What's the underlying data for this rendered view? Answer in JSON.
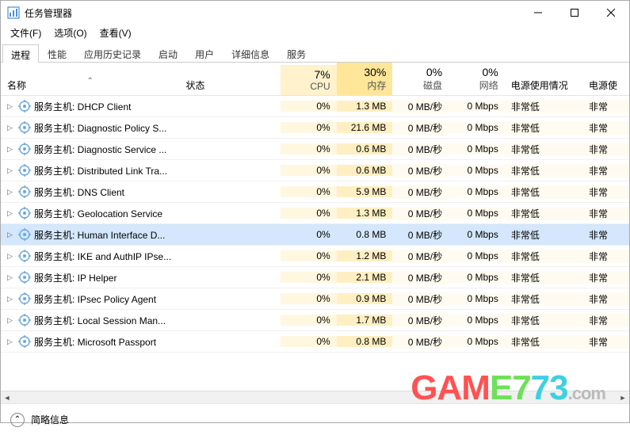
{
  "window": {
    "title": "任务管理器"
  },
  "menu": {
    "file": "文件(F)",
    "options": "选项(O)",
    "view": "查看(V)"
  },
  "tabs": [
    "进程",
    "性能",
    "应用历史记录",
    "启动",
    "用户",
    "详细信息",
    "服务"
  ],
  "active_tab": 0,
  "columns": {
    "name": "名称",
    "status": "状态",
    "cpu": {
      "pct": "7%",
      "lbl": "CPU"
    },
    "mem": {
      "pct": "30%",
      "lbl": "内存"
    },
    "disk": {
      "pct": "0%",
      "lbl": "磁盘"
    },
    "net": {
      "pct": "0%",
      "lbl": "网络"
    },
    "power": "电源使用情况",
    "power2": "电源使"
  },
  "rows": [
    {
      "name": "服务主机: DHCP Client",
      "cpu": "0%",
      "mem": "1.3 MB",
      "disk": "0 MB/秒",
      "net": "0 Mbps",
      "power": "非常低",
      "power2": "非常"
    },
    {
      "name": "服务主机: Diagnostic Policy S...",
      "cpu": "0%",
      "mem": "21.6 MB",
      "disk": "0 MB/秒",
      "net": "0 Mbps",
      "power": "非常低",
      "power2": "非常"
    },
    {
      "name": "服务主机: Diagnostic Service ...",
      "cpu": "0%",
      "mem": "0.6 MB",
      "disk": "0 MB/秒",
      "net": "0 Mbps",
      "power": "非常低",
      "power2": "非常"
    },
    {
      "name": "服务主机: Distributed Link Tra...",
      "cpu": "0%",
      "mem": "0.6 MB",
      "disk": "0 MB/秒",
      "net": "0 Mbps",
      "power": "非常低",
      "power2": "非常"
    },
    {
      "name": "服务主机: DNS Client",
      "cpu": "0%",
      "mem": "5.9 MB",
      "disk": "0 MB/秒",
      "net": "0 Mbps",
      "power": "非常低",
      "power2": "非常"
    },
    {
      "name": "服务主机: Geolocation Service",
      "cpu": "0%",
      "mem": "1.3 MB",
      "disk": "0 MB/秒",
      "net": "0 Mbps",
      "power": "非常低",
      "power2": "非常"
    },
    {
      "name": "服务主机: Human Interface D...",
      "cpu": "0%",
      "mem": "0.8 MB",
      "disk": "0 MB/秒",
      "net": "0 Mbps",
      "power": "非常低",
      "power2": "非常",
      "selected": true
    },
    {
      "name": "服务主机: IKE and AuthIP IPse...",
      "cpu": "0%",
      "mem": "1.2 MB",
      "disk": "0 MB/秒",
      "net": "0 Mbps",
      "power": "非常低",
      "power2": "非常"
    },
    {
      "name": "服务主机: IP Helper",
      "cpu": "0%",
      "mem": "2.1 MB",
      "disk": "0 MB/秒",
      "net": "0 Mbps",
      "power": "非常低",
      "power2": "非常"
    },
    {
      "name": "服务主机: IPsec Policy Agent",
      "cpu": "0%",
      "mem": "0.9 MB",
      "disk": "0 MB/秒",
      "net": "0 Mbps",
      "power": "非常低",
      "power2": "非常"
    },
    {
      "name": "服务主机: Local Session Man...",
      "cpu": "0%",
      "mem": "1.7 MB",
      "disk": "0 MB/秒",
      "net": "0 Mbps",
      "power": "非常低",
      "power2": "非常"
    },
    {
      "name": "服务主机: Microsoft Passport",
      "cpu": "0%",
      "mem": "0.8 MB",
      "disk": "0 MB/秒",
      "net": "0 Mbps",
      "power": "非常低",
      "power2": "非常"
    }
  ],
  "footer": {
    "label": "简略信息"
  },
  "watermark": {
    "t1": "GAM",
    "t2": "E7",
    "t3": "73",
    "dot": ".",
    "com": "com"
  }
}
